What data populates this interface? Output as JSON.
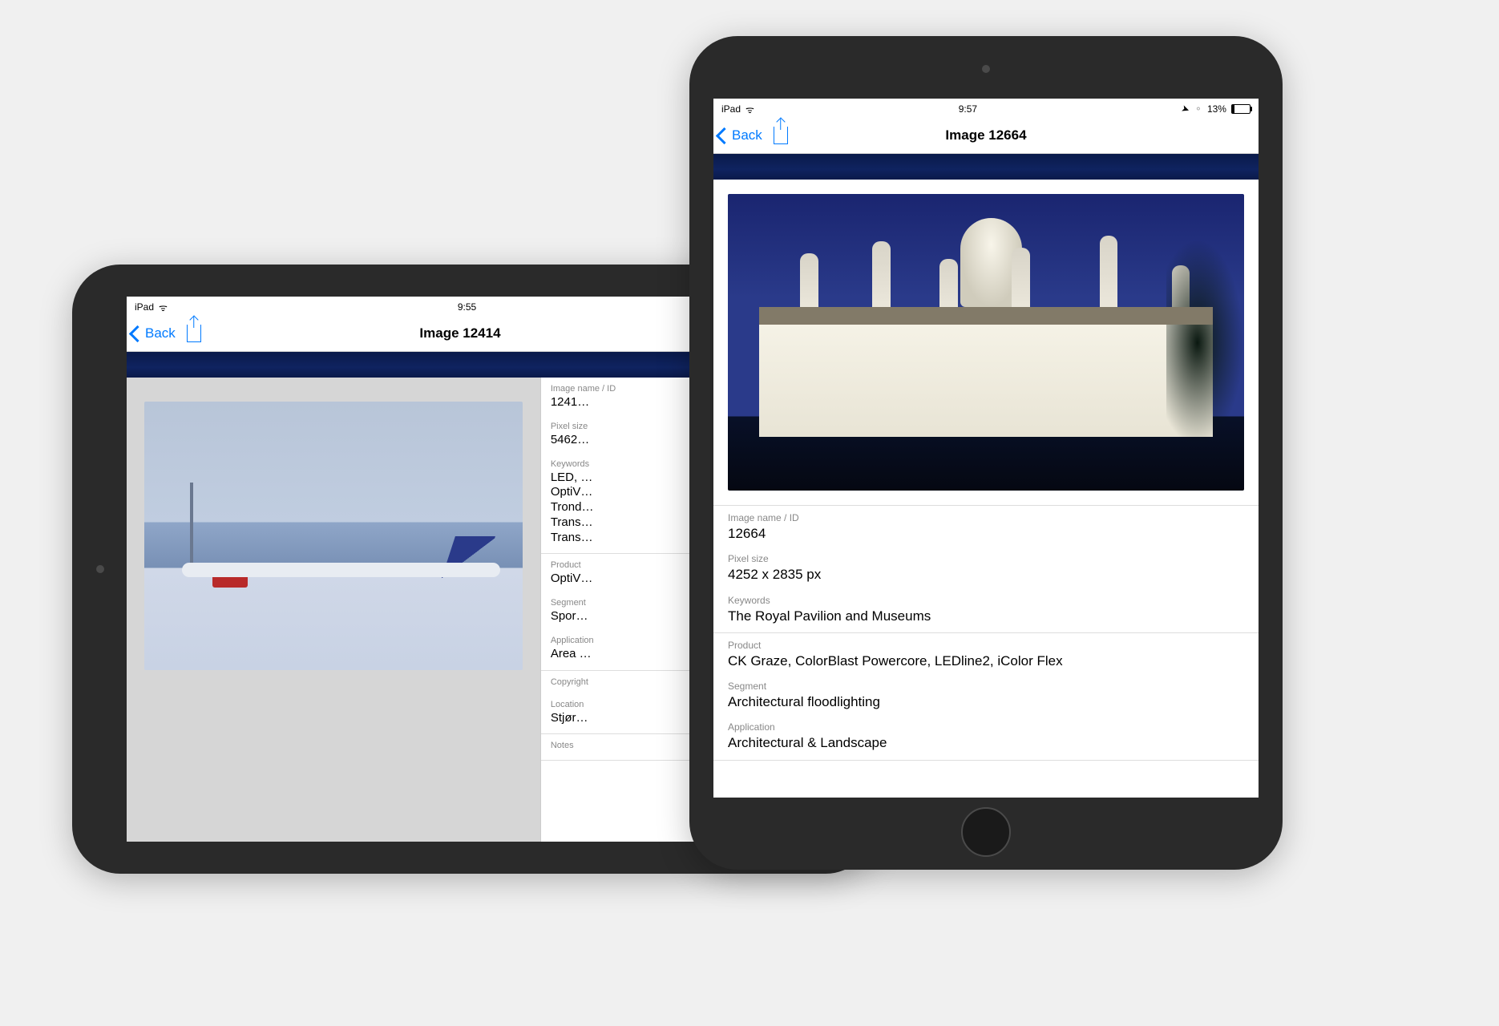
{
  "landscape": {
    "status": {
      "carrier": "iPad",
      "time": "9:55"
    },
    "nav": {
      "back": "Back",
      "title": "Image 12414"
    },
    "meta": {
      "image_name_label": "Image name / ID",
      "image_name": "1241…",
      "pixel_label": "Pixel size",
      "pixel": "5462…",
      "keywords_label": "Keywords",
      "keywords": "LED, …\nOptiV…\nTrond…\nTrans…\nTrans…",
      "product_label": "Product",
      "product": "OptiV…",
      "segment_label": "Segment",
      "segment": "Spor…",
      "application_label": "Application",
      "application": "Area …",
      "copyright_label": "Copyright",
      "location_label": "Location",
      "location": "Stjør…",
      "notes_label": "Notes"
    }
  },
  "portrait": {
    "status": {
      "carrier": "iPad",
      "time": "9:57",
      "battery": "13%"
    },
    "nav": {
      "back": "Back",
      "title": "Image 12664"
    },
    "meta": {
      "image_name_label": "Image name / ID",
      "image_name": "12664",
      "pixel_label": "Pixel size",
      "pixel": "4252 x 2835 px",
      "keywords_label": "Keywords",
      "keywords": "The Royal Pavilion and Museums",
      "product_label": "Product",
      "product": "CK Graze, ColorBlast Powercore, LEDline2, iColor Flex",
      "segment_label": "Segment",
      "segment": "Architectural floodlighting",
      "application_label": "Application",
      "application": "Architectural & Landscape"
    }
  }
}
